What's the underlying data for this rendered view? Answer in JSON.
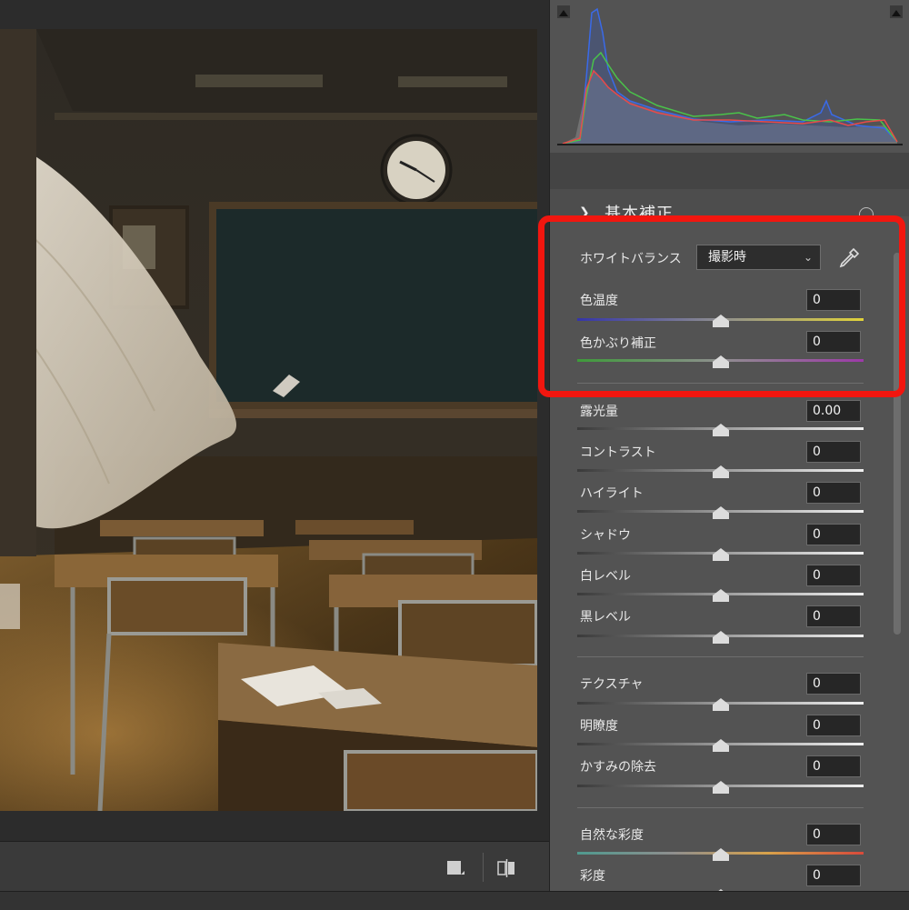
{
  "section": {
    "title": "基本補正"
  },
  "white_balance": {
    "label": "ホワイトバランス",
    "selected": "撮影時",
    "eyedropper_icon": "eyedropper-icon"
  },
  "sliders": {
    "temperature": {
      "label": "色温度",
      "value": "0",
      "position": 0.5
    },
    "tint": {
      "label": "色かぶり補正",
      "value": "0",
      "position": 0.5
    },
    "exposure": {
      "label": "露光量",
      "value": "0.00",
      "position": 0.5
    },
    "contrast": {
      "label": "コントラスト",
      "value": "0",
      "position": 0.5
    },
    "highlights": {
      "label": "ハイライト",
      "value": "0",
      "position": 0.5
    },
    "shadows": {
      "label": "シャドウ",
      "value": "0",
      "position": 0.5
    },
    "whites": {
      "label": "白レベル",
      "value": "0",
      "position": 0.5
    },
    "blacks": {
      "label": "黒レベル",
      "value": "0",
      "position": 0.5
    },
    "texture": {
      "label": "テクスチャ",
      "value": "0",
      "position": 0.5
    },
    "clarity": {
      "label": "明瞭度",
      "value": "0",
      "position": 0.5
    },
    "dehaze": {
      "label": "かすみの除去",
      "value": "0",
      "position": 0.5
    },
    "vibrance": {
      "label": "自然な彩度",
      "value": "0",
      "position": 0.5
    },
    "saturation": {
      "label": "彩度",
      "value": "0",
      "position": 0.5
    }
  },
  "colors": {
    "highlight": "#f2160f",
    "panel_bg": "#535353",
    "temperature_gradient": [
      "#3535a8",
      "#8f8f8f",
      "#e0d23a"
    ],
    "tint_gradient": [
      "#3e9a3a",
      "#8f8f8f",
      "#9c3aa8"
    ],
    "vibrance_gradient": [
      "#4f9a8f",
      "#8f8f8f",
      "#d8a24a",
      "#d84a3a"
    ]
  },
  "icons": {
    "view_mode": "single-view-icon",
    "compare": "before-after-icon",
    "histogram_clip_left": "shadow-clipping-icon",
    "histogram_clip_right": "highlight-clipping-icon"
  }
}
